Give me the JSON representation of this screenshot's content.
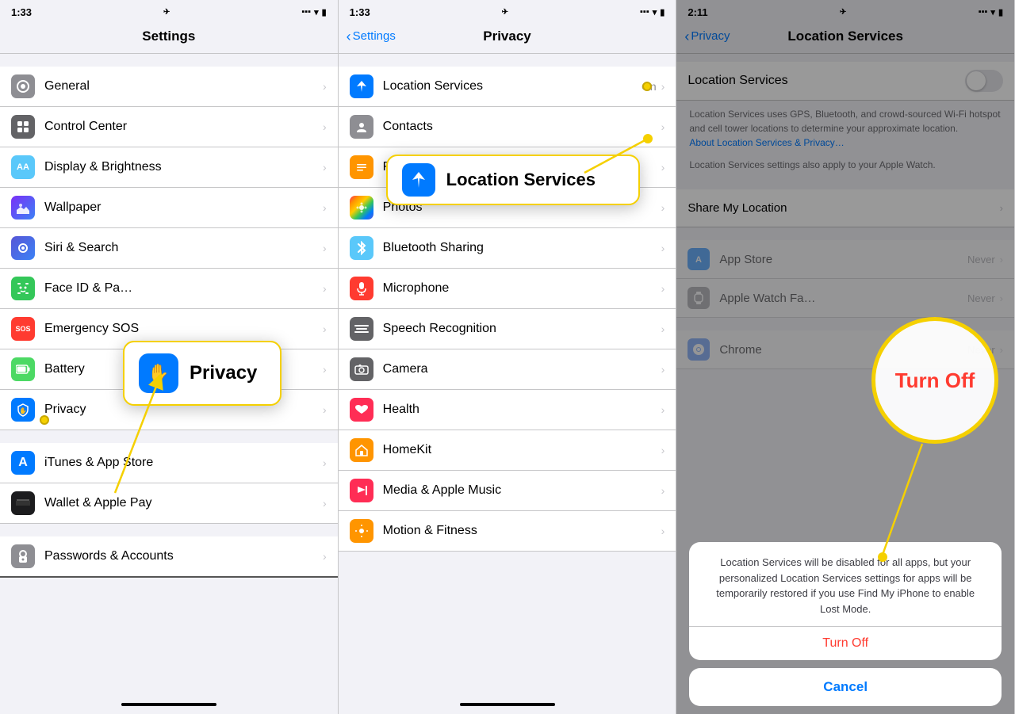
{
  "panel1": {
    "status": {
      "time": "1:33",
      "arrow": "↑",
      "signal": "▪▪▪",
      "wifi": "wifi",
      "battery": "🔋"
    },
    "nav_title": "Settings",
    "items": [
      {
        "id": "general",
        "icon": "⚙️",
        "icon_color": "icon-gray",
        "label": "General",
        "value": ""
      },
      {
        "id": "control-center",
        "icon": "🔲",
        "icon_color": "icon-gray2",
        "label": "Control Center",
        "value": ""
      },
      {
        "id": "display",
        "icon": "AA",
        "icon_color": "icon-blue2",
        "label": "Display & Brightness",
        "value": ""
      },
      {
        "id": "wallpaper",
        "icon": "✦",
        "icon_color": "icon-purple",
        "label": "Wallpaper",
        "value": ""
      },
      {
        "id": "siri",
        "icon": "◉",
        "icon_color": "icon-indigo",
        "label": "Siri & Search",
        "value": ""
      },
      {
        "id": "faceid",
        "icon": "👁",
        "icon_color": "icon-green",
        "label": "Face ID & Passcode",
        "value": ""
      },
      {
        "id": "emergency",
        "icon": "SOS",
        "icon_color": "icon-red",
        "label": "Emergency SOS",
        "value": ""
      },
      {
        "id": "battery",
        "icon": "🔋",
        "icon_color": "icon-green2",
        "label": "Battery",
        "value": ""
      },
      {
        "id": "privacy",
        "icon": "✋",
        "icon_color": "icon-blue",
        "label": "Privacy",
        "value": "",
        "annotated": true
      }
    ],
    "items2": [
      {
        "id": "itunes",
        "icon": "A",
        "icon_color": "icon-blue",
        "label": "iTunes & App Store",
        "value": ""
      },
      {
        "id": "wallet",
        "icon": "▬",
        "icon_color": "icon-gray2",
        "label": "Wallet & Apple Pay",
        "value": ""
      }
    ],
    "items3": [
      {
        "id": "passwords",
        "icon": "🔑",
        "icon_color": "icon-gray",
        "label": "Passwords & Accounts",
        "value": ""
      }
    ],
    "callout_label": "Privacy",
    "callout_icon": "✋"
  },
  "panel2": {
    "status": {
      "time": "1:33",
      "arrow": "↑"
    },
    "nav_back": "Settings",
    "nav_title": "Privacy",
    "items": [
      {
        "id": "location",
        "icon": "➤",
        "icon_color": "icon-blue",
        "label": "Location Services",
        "value": "On",
        "annotated": true
      },
      {
        "id": "contacts",
        "icon": "👤",
        "icon_color": "icon-gray",
        "label": "Contacts",
        "value": ""
      },
      {
        "id": "reminders",
        "icon": "☰",
        "icon_color": "icon-orange",
        "label": "Reminders",
        "value": ""
      },
      {
        "id": "photos",
        "icon": "🌸",
        "icon_color": "icon-pink",
        "label": "Photos",
        "value": ""
      },
      {
        "id": "bluetooth",
        "icon": "✦",
        "icon_color": "icon-blue2",
        "label": "Bluetooth Sharing",
        "value": ""
      },
      {
        "id": "microphone",
        "icon": "🎙",
        "icon_color": "icon-red",
        "label": "Microphone",
        "value": ""
      },
      {
        "id": "speech",
        "icon": "≋",
        "icon_color": "icon-gray2",
        "label": "Speech Recognition",
        "value": ""
      },
      {
        "id": "camera",
        "icon": "📷",
        "icon_color": "icon-gray",
        "label": "Camera",
        "value": ""
      },
      {
        "id": "health",
        "icon": "♥",
        "icon_color": "icon-pink",
        "label": "Health",
        "value": ""
      },
      {
        "id": "homekit",
        "icon": "⌂",
        "icon_color": "icon-orange",
        "label": "HomeKit",
        "value": ""
      },
      {
        "id": "media",
        "icon": "♪",
        "icon_color": "icon-pink",
        "label": "Media & Apple Music",
        "value": ""
      },
      {
        "id": "motion",
        "icon": "☰",
        "icon_color": "icon-orange",
        "label": "Motion & Fitness",
        "value": ""
      }
    ],
    "callout_label": "Location Services",
    "callout_icon": "➤"
  },
  "panel3": {
    "status": {
      "time": "2:11",
      "arrow": "↑"
    },
    "nav_back": "Privacy",
    "nav_title": "Location Services",
    "section_title": "Location Services",
    "desc1": "Location Services uses GPS, Bluetooth, and crowd-sourced Wi-Fi hotspot and cell tower locations to determine your approximate location.",
    "desc_link": "About Location Services & Privacy…",
    "desc2": "Location Services settings also apply to your Apple Watch.",
    "share_label": "Share My Location",
    "apps": [
      {
        "id": "appstore",
        "icon": "A",
        "icon_color": "icon-blue",
        "label": "App Store",
        "value": "Never"
      },
      {
        "id": "applewatch",
        "icon": "⌚",
        "icon_color": "icon-gray",
        "label": "Apple Watch Fa…",
        "value": "Never"
      },
      {
        "id": "chrome",
        "icon": "G",
        "icon_color": "icon-blue2",
        "label": "Chrome",
        "value": "Never"
      }
    ],
    "alert_text": "Location Services will be disabled for all apps, but your personalized Location Services settings for apps will be temporarily restored if you use Find My iPhone to enable Lost Mode.",
    "alert_turnoff": "Turn Off",
    "alert_cancel": "Cancel",
    "turnoff_circle_text": "Turn Off"
  }
}
